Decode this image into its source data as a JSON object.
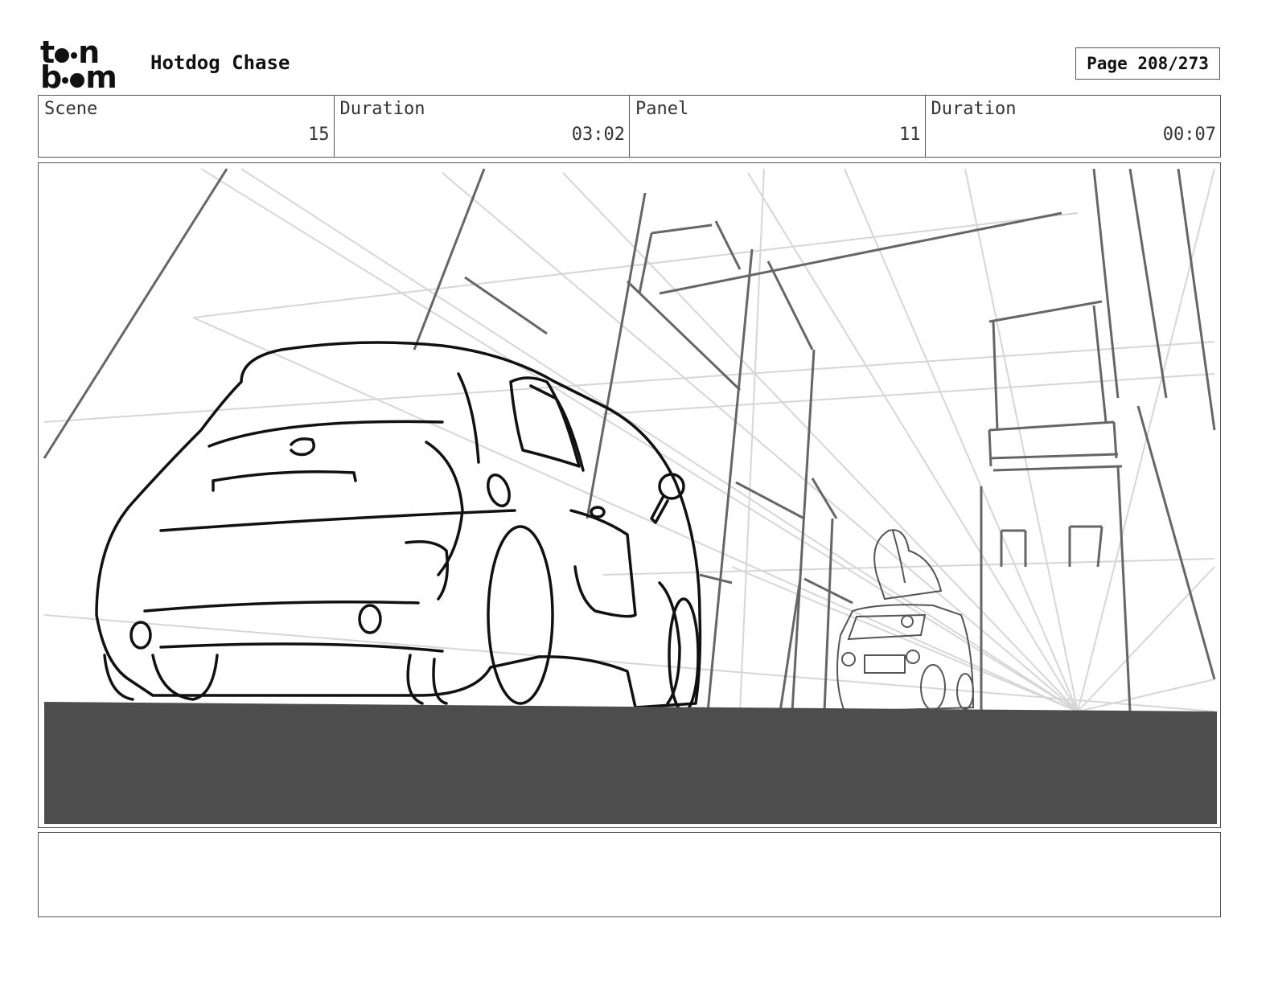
{
  "header": {
    "logo_top": "t",
    "logo_top_end": "n",
    "logo_bottom_start": "b",
    "logo_bottom_end": "m",
    "title": "Hotdog Chase",
    "page_label": "Page 208/273"
  },
  "info": [
    {
      "label": "Scene",
      "value": "15"
    },
    {
      "label": "Duration",
      "value": "03:02"
    },
    {
      "label": "Panel",
      "value": "11"
    },
    {
      "label": "Duration",
      "value": "00:07"
    }
  ],
  "panel": {
    "ground_color": "#4d4d4d",
    "sketch_color": "#111111",
    "guide_color": "#d4d4d4",
    "building_color": "#666666"
  },
  "notes": {
    "text": ""
  }
}
